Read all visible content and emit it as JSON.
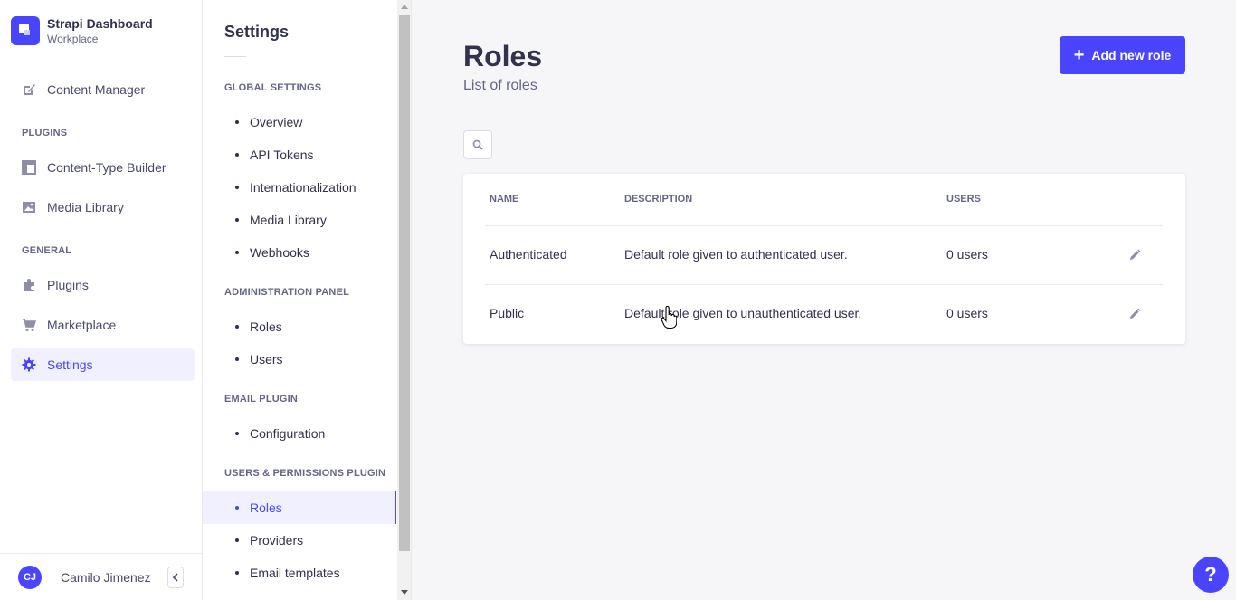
{
  "brand": {
    "title": "Strapi Dashboard",
    "subtitle": "Workplace"
  },
  "mainnav": {
    "content_manager": "Content Manager",
    "plugins_section": "PLUGINS",
    "content_type_builder": "Content-Type Builder",
    "media_library": "Media Library",
    "general_section": "GENERAL",
    "plugins": "Plugins",
    "marketplace": "Marketplace",
    "settings": "Settings"
  },
  "profile": {
    "initials": "CJ",
    "name": "Camilo Jimenez"
  },
  "subnav": {
    "title": "Settings",
    "global_section": "GLOBAL SETTINGS",
    "global_items": [
      "Overview",
      "API Tokens",
      "Internationalization",
      "Media Library",
      "Webhooks"
    ],
    "admin_section": "ADMINISTRATION PANEL",
    "admin_items": [
      "Roles",
      "Users"
    ],
    "email_section": "EMAIL PLUGIN",
    "email_items": [
      "Configuration"
    ],
    "up_section": "USERS & PERMISSIONS PLUGIN",
    "up_items": [
      "Roles",
      "Providers",
      "Email templates"
    ]
  },
  "page": {
    "title": "Roles",
    "subtitle": "List of roles",
    "add_button": "Add new role"
  },
  "table": {
    "headers": {
      "name": "NAME",
      "description": "DESCRIPTION",
      "users": "USERS"
    },
    "rows": [
      {
        "name": "Authenticated",
        "description": "Default role given to authenticated user.",
        "users": "0 users"
      },
      {
        "name": "Public",
        "description": "Default role given to unauthenticated user.",
        "users": "0 users"
      }
    ]
  },
  "help": "?",
  "colors": {
    "primary": "#4945ff",
    "active_bg": "#f0f0ff"
  }
}
